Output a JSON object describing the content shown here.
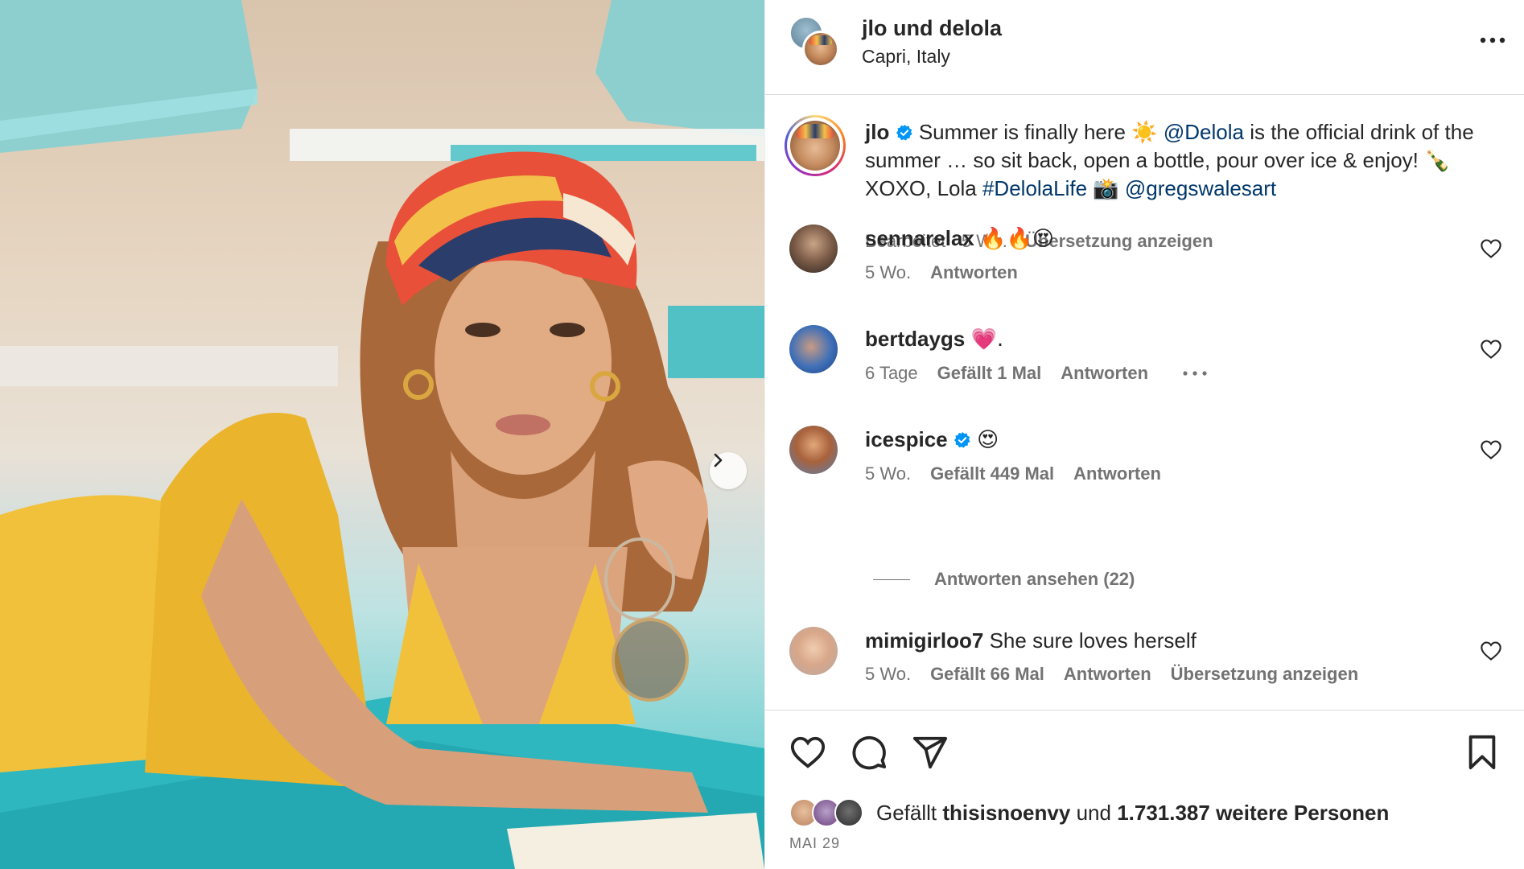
{
  "post": {
    "header": {
      "title": "jlo und delola",
      "location": "Capri, Italy"
    },
    "caption": {
      "username": "jlo",
      "text_part1": "Summer is finally here",
      "emoji_sun": "☀️",
      "mention_1": "@Delola",
      "text_part2": "is the official drink of the summer … so sit back, open a bottle, pour over ice & enjoy!",
      "emoji_bottle": "🍾",
      "text_part3": "XOXO, Lola",
      "hashtag": "#DelolaLife",
      "emoji_camera": "📸",
      "mention_2": "@gregswalesart",
      "edited": "Bearbeitet",
      "age": "5 Wo.",
      "translate": "Übersetzung anzeigen"
    },
    "comments": [
      {
        "username": "sennarelax",
        "text": "🔥🔥😍",
        "age": "5 Wo.",
        "likes": "",
        "reply": "Antworten",
        "translate": ""
      },
      {
        "username": "bertdaygs",
        "text": "💗.",
        "age": "6 Tage",
        "likes": "Gefällt 1 Mal",
        "reply": "Antworten",
        "translate": ""
      },
      {
        "username": "icespice",
        "text": "😍",
        "age": "5 Wo.",
        "likes": "Gefällt 449 Mal",
        "reply": "Antworten",
        "translate": ""
      },
      {
        "username": "mimigirloo7",
        "text": "She sure loves herself",
        "age": "5 Wo.",
        "likes": "Gefällt 66 Mal",
        "reply": "Antworten",
        "translate": "Übersetzung anzeigen"
      }
    ],
    "view_replies": "Antworten ansehen (22)",
    "likes": {
      "prefix": "Gefällt",
      "user": "thisisnoenvy",
      "connector": "und",
      "count": "1.731.387 weitere Personen"
    },
    "date": "MAI 29"
  },
  "icons": [
    "chevron-right-icon",
    "more-icon",
    "verified-icon",
    "heart-icon",
    "comment-icon",
    "share-icon",
    "bookmark-icon",
    "ellipsis-icon"
  ],
  "colors": {
    "text": "#262626",
    "secondary": "#737373",
    "link": "#00376b",
    "verified": "#0095f6",
    "divider": "#dbdbdb"
  }
}
